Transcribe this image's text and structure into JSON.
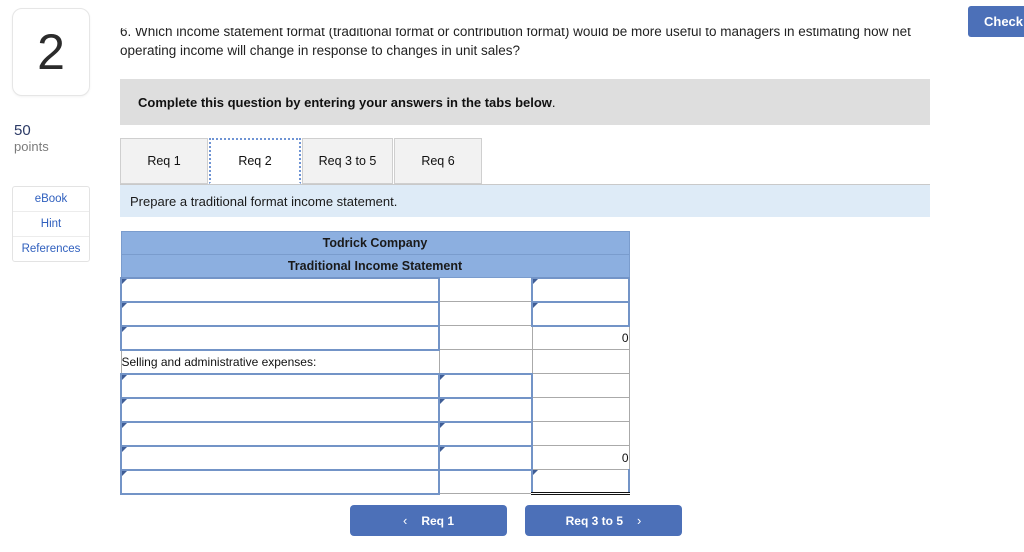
{
  "question": {
    "number": "2",
    "points_value": "50",
    "points_label": "points",
    "text_line1": "6. Which income statement format (traditional format or contribution format) would be more useful to managers in estimating how net",
    "text_line2": "operating income will change in response to changes in unit sales?"
  },
  "rail_links": [
    {
      "label": "eBook",
      "name": "ebook-link"
    },
    {
      "label": "Hint",
      "name": "hint-link"
    },
    {
      "label": "References",
      "name": "references-link"
    }
  ],
  "check_button": {
    "label": "Check"
  },
  "complete_banner": {
    "bold_text": "Complete this question by entering your answers in the tabs below",
    "trailing": "."
  },
  "tabs": [
    {
      "label": "Req 1",
      "active": false
    },
    {
      "label": "Req 2",
      "active": true
    },
    {
      "label": "Req 3 to 5",
      "active": false
    },
    {
      "label": "Req 6",
      "active": false
    }
  ],
  "instruction": "Prepare a traditional format income statement.",
  "worksheet": {
    "title": "Todrick Company",
    "subtitle": "Traditional Income Statement",
    "rows": [
      {
        "label": "",
        "col2": "",
        "col3": "",
        "label_input": true,
        "col2_input": false,
        "col3_input": true,
        "style": ""
      },
      {
        "label": "",
        "col2": "",
        "col3": "",
        "label_input": true,
        "col2_input": false,
        "col3_input": true,
        "style": ""
      },
      {
        "label": "",
        "col2": "",
        "col3": "0",
        "label_input": true,
        "col2_input": false,
        "col3_input": false,
        "style": "uline"
      },
      {
        "label": "Selling and administrative expenses:",
        "col2": "",
        "col3": "",
        "label_input": false,
        "col2_input": false,
        "col3_input": false,
        "style": ""
      },
      {
        "label": "",
        "col2": "",
        "col3": "",
        "label_input": true,
        "col2_input": true,
        "col3_input": false,
        "style": ""
      },
      {
        "label": "",
        "col2": "",
        "col3": "",
        "label_input": true,
        "col2_input": true,
        "col3_input": false,
        "style": ""
      },
      {
        "label": "",
        "col2": "",
        "col3": "",
        "label_input": true,
        "col2_input": true,
        "col3_input": false,
        "style": ""
      },
      {
        "label": "",
        "col2": "",
        "col3": "0",
        "label_input": true,
        "col2_input": true,
        "col3_input": false,
        "style": ""
      },
      {
        "label": "",
        "col2": "",
        "col3": "",
        "label_input": true,
        "col2_input": false,
        "col3_input": true,
        "style": "dbl"
      }
    ]
  },
  "nav": {
    "prev_label": "Req 1",
    "prev_icon": "chevron-left-icon",
    "prev_glyph": "‹",
    "next_label": "Req 3 to 5",
    "next_icon": "chevron-right-icon",
    "next_glyph": "›"
  },
  "colors": {
    "accent_blue": "#4c70b8",
    "table_header_blue": "#8cafe0",
    "instruction_blue": "#deebf7",
    "banner_gray": "#dedede",
    "input_border": "#7394c7"
  }
}
